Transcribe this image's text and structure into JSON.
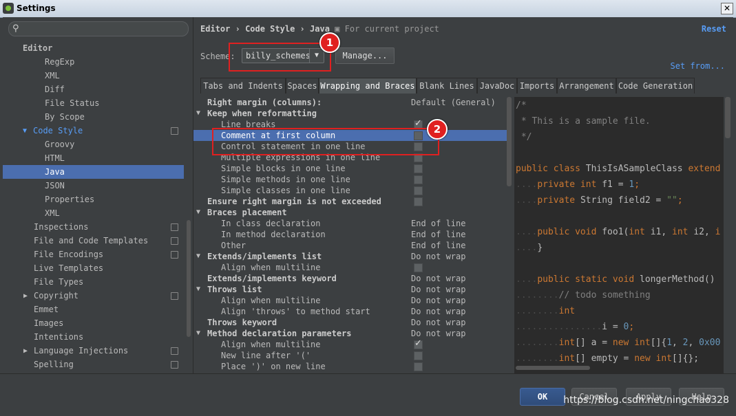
{
  "window": {
    "title": "Settings",
    "close_glyph": "✕"
  },
  "search": {
    "icon": "search-icon"
  },
  "nav": {
    "items": [
      {
        "label": "Editor",
        "bold": true
      },
      {
        "label": "RegExp"
      },
      {
        "label": "XML"
      },
      {
        "label": "Diff"
      },
      {
        "label": "File Status"
      },
      {
        "label": "By Scope"
      },
      {
        "label": "Code Style",
        "expanded": true
      },
      {
        "label": "Groovy"
      },
      {
        "label": "HTML"
      },
      {
        "label": "Java",
        "selected": true
      },
      {
        "label": "JSON"
      },
      {
        "label": "Properties"
      },
      {
        "label": "XML"
      },
      {
        "label": "Inspections"
      },
      {
        "label": "File and Code Templates"
      },
      {
        "label": "File Encodings"
      },
      {
        "label": "Live Templates"
      },
      {
        "label": "File Types"
      },
      {
        "label": "Copyright"
      },
      {
        "label": "Emmet"
      },
      {
        "label": "Images"
      },
      {
        "label": "Intentions"
      },
      {
        "label": "Language Injections"
      },
      {
        "label": "Spelling"
      }
    ]
  },
  "header": {
    "crumb1": "Editor",
    "sep": "›",
    "crumb2": "Code Style",
    "crumb3": "Java",
    "project_note": "For current project",
    "reset": "Reset"
  },
  "scheme": {
    "label": "Scheme:",
    "value": "billy_schemes",
    "manage": "Manage...",
    "set_from": "Set from..."
  },
  "tabs": [
    "Tabs and Indents",
    "Spaces",
    "Wrapping and Braces",
    "Blank Lines",
    "JavaDoc",
    "Imports",
    "Arrangement",
    "Code Generation"
  ],
  "active_tab": "Wrapping and Braces",
  "options": [
    {
      "label": "Right margin (columns):",
      "kind": "header",
      "value": "Default (General)"
    },
    {
      "label": "Keep when reformatting",
      "kind": "group"
    },
    {
      "label": "Line breaks",
      "kind": "child",
      "checked": true
    },
    {
      "label": "Comment at first column",
      "kind": "child",
      "checked": false,
      "selected": true
    },
    {
      "label": "Control statement in one line",
      "kind": "child",
      "checked": false
    },
    {
      "label": "Multiple expressions in one line",
      "kind": "child",
      "checked": false
    },
    {
      "label": "Simple blocks in one line",
      "kind": "child",
      "checked": false
    },
    {
      "label": "Simple methods in one line",
      "kind": "child",
      "checked": false
    },
    {
      "label": "Simple classes in one line",
      "kind": "child",
      "checked": false
    },
    {
      "label": "Ensure right margin is not exceeded",
      "kind": "header",
      "checked": false
    },
    {
      "label": "Braces placement",
      "kind": "group"
    },
    {
      "label": "In class declaration",
      "kind": "child",
      "value": "End of line"
    },
    {
      "label": "In method declaration",
      "kind": "child",
      "value": "End of line"
    },
    {
      "label": "Other",
      "kind": "child",
      "value": "End of line"
    },
    {
      "label": "Extends/implements list",
      "kind": "group",
      "value": "Do not wrap"
    },
    {
      "label": "Align when multiline",
      "kind": "child",
      "checked": false
    },
    {
      "label": "Extends/implements keyword",
      "kind": "header",
      "value": "Do not wrap"
    },
    {
      "label": "Throws list",
      "kind": "group",
      "value": "Do not wrap"
    },
    {
      "label": "Align when multiline",
      "kind": "child",
      "value": "Do not wrap"
    },
    {
      "label": "Align 'throws' to method start",
      "kind": "child",
      "value": "Do not wrap"
    },
    {
      "label": "Throws keyword",
      "kind": "header",
      "value": "Do not wrap"
    },
    {
      "label": "Method declaration parameters",
      "kind": "group",
      "value": "Do not wrap"
    },
    {
      "label": "Align when multiline",
      "kind": "child",
      "checked": true
    },
    {
      "label": "New line after '('",
      "kind": "child",
      "checked": false
    },
    {
      "label": "Place ')' on new line",
      "kind": "child",
      "checked": false
    }
  ],
  "code": [
    [
      {
        "t": "/*",
        "c": "cmt"
      }
    ],
    [
      {
        "t": " * This is a sample file.",
        "c": "cmt"
      }
    ],
    [
      {
        "t": " */",
        "c": "cmt"
      }
    ],
    [],
    [
      {
        "t": "public class ",
        "c": "kw"
      },
      {
        "t": "ThisIsASampleClass ",
        "c": ""
      },
      {
        "t": "extend",
        "c": "kw"
      }
    ],
    [
      {
        "t": "....",
        "c": "dots"
      },
      {
        "t": "private int ",
        "c": "kw"
      },
      {
        "t": "f1 = ",
        "c": ""
      },
      {
        "t": "1",
        "c": "num"
      },
      {
        "t": ";",
        "c": "kw"
      }
    ],
    [
      {
        "t": "....",
        "c": "dots"
      },
      {
        "t": "private ",
        "c": "kw"
      },
      {
        "t": "String field2 = ",
        "c": ""
      },
      {
        "t": "\"\"",
        "c": "str"
      },
      {
        "t": ";",
        "c": "kw"
      }
    ],
    [],
    [
      {
        "t": "....",
        "c": "dots"
      },
      {
        "t": "public void ",
        "c": "kw"
      },
      {
        "t": "foo1(",
        "c": ""
      },
      {
        "t": "int ",
        "c": "kw"
      },
      {
        "t": "i1, ",
        "c": ""
      },
      {
        "t": "int ",
        "c": "kw"
      },
      {
        "t": "i2, ",
        "c": ""
      },
      {
        "t": "i",
        "c": "kw"
      }
    ],
    [
      {
        "t": "....",
        "c": "dots"
      },
      {
        "t": "}",
        "c": ""
      }
    ],
    [],
    [
      {
        "t": "....",
        "c": "dots"
      },
      {
        "t": "public static void ",
        "c": "kw"
      },
      {
        "t": "longerMethod()",
        "c": ""
      }
    ],
    [
      {
        "t": "........",
        "c": "dots"
      },
      {
        "t": "// todo something",
        "c": "cmt"
      }
    ],
    [
      {
        "t": "........",
        "c": "dots"
      },
      {
        "t": "int",
        "c": "kw"
      }
    ],
    [
      {
        "t": "................",
        "c": "dots"
      },
      {
        "t": "i = ",
        "c": ""
      },
      {
        "t": "0",
        "c": "num"
      },
      {
        "t": ";",
        "c": "kw"
      }
    ],
    [
      {
        "t": "........",
        "c": "dots"
      },
      {
        "t": "int",
        "c": "kw"
      },
      {
        "t": "[] a = ",
        "c": ""
      },
      {
        "t": "new int",
        "c": "kw"
      },
      {
        "t": "[]{",
        "c": ""
      },
      {
        "t": "1",
        "c": "num"
      },
      {
        "t": ", ",
        "c": ""
      },
      {
        "t": "2",
        "c": "num"
      },
      {
        "t": ", ",
        "c": ""
      },
      {
        "t": "0x00",
        "c": "num"
      }
    ],
    [
      {
        "t": "........",
        "c": "dots"
      },
      {
        "t": "int",
        "c": "kw"
      },
      {
        "t": "[] empty = ",
        "c": ""
      },
      {
        "t": "new int",
        "c": "kw"
      },
      {
        "t": "[]{};",
        "c": ""
      }
    ]
  ],
  "buttons": {
    "ok": "OK",
    "cancel": "Cancel",
    "apply": "Apply",
    "help": "Help"
  },
  "watermark": "https://blog.csdn.net/ningchao328",
  "annotations": {
    "badge1": "1",
    "badge2": "2",
    "color": "#e02020"
  }
}
